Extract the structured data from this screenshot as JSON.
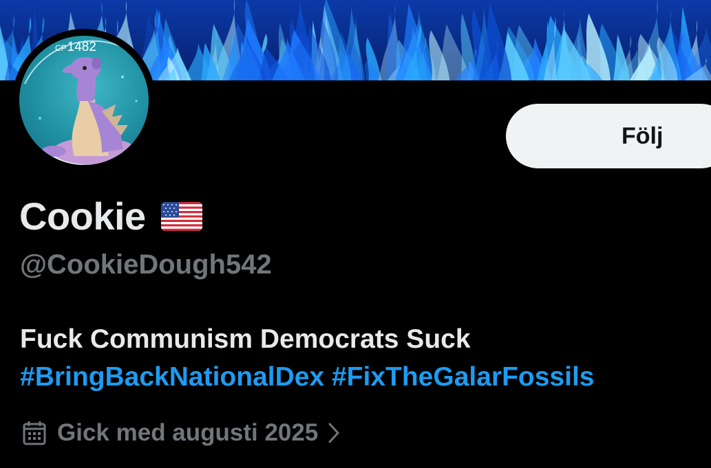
{
  "banner": {
    "description_icon": "blue-flames-banner"
  },
  "avatar": {
    "cp_prefix": "CP",
    "cp_value": "1482"
  },
  "follow_button": {
    "label": "Följ"
  },
  "profile": {
    "display_name": "Cookie",
    "flag": "🇺🇸",
    "handle": "@CookieDough542",
    "bio_line1": "Fuck Communism Democrats Suck",
    "hashtags": [
      "#BringBackNationalDex",
      "#FixTheGalarFossils"
    ],
    "joined": "Gick med augusti 2025"
  },
  "colors": {
    "background": "#000000",
    "text_primary": "#e7e9ea",
    "text_secondary": "#71767b",
    "link": "#1d9bf0",
    "button_bg": "#eff3f4"
  }
}
